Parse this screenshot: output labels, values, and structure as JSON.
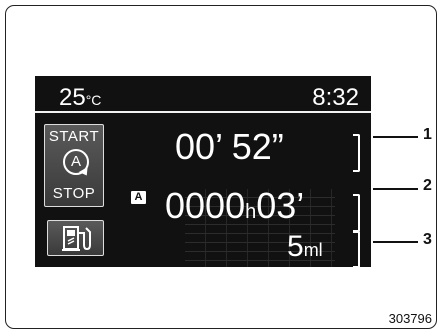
{
  "display": {
    "temperature_value": "25",
    "temperature_unit": "°C",
    "clock": "8:32"
  },
  "start_stop": {
    "start_label": "START",
    "center_label": "A",
    "stop_label": "STOP"
  },
  "mode_badge": "A",
  "readouts": {
    "stop_time": "00’ 52”",
    "total_time_hours": "0000",
    "total_time_hours_unit": "h",
    "total_time_minutes": "03’",
    "fuel_saved_value": "5",
    "fuel_saved_unit": "ml"
  },
  "callouts": [
    "1",
    "2",
    "3"
  ],
  "reference_number": "303796",
  "icons": [
    "start-stop-icon",
    "fuel-pump-icon"
  ],
  "colors": {
    "screen_background": "#111111",
    "text": "#ffffff"
  }
}
